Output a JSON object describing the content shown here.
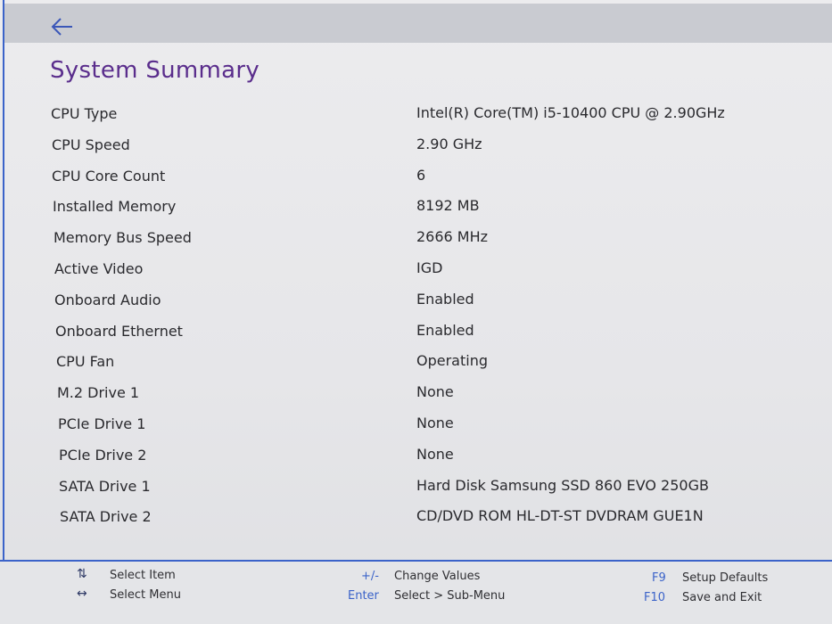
{
  "header": {
    "back_icon": "arrow-left-icon"
  },
  "page": {
    "title": "System Summary"
  },
  "summary": {
    "rows": [
      {
        "label": "CPU Type",
        "value": "Intel(R) Core(TM) i5-10400 CPU @ 2.90GHz"
      },
      {
        "label": "CPU Speed",
        "value": "2.90 GHz"
      },
      {
        "label": "CPU Core Count",
        "value": "6"
      },
      {
        "label": "Installed Memory",
        "value": "8192 MB"
      },
      {
        "label": "Memory Bus Speed",
        "value": "2666 MHz"
      },
      {
        "label": "Active Video",
        "value": "IGD"
      },
      {
        "label": "Onboard Audio",
        "value": "Enabled"
      },
      {
        "label": "Onboard Ethernet",
        "value": "Enabled"
      },
      {
        "label": "CPU Fan",
        "value": "Operating"
      },
      {
        "label": "M.2 Drive 1",
        "value": "None"
      },
      {
        "label": "PCIe Drive 1",
        "value": "None"
      },
      {
        "label": "PCIe Drive 2",
        "value": "None"
      },
      {
        "label": "SATA Drive 1",
        "value": "Hard Disk Samsung SSD 860 EVO 250GB"
      },
      {
        "label": "SATA Drive 2",
        "value": "CD/DVD ROM HL-DT-ST DVDRAM GUE1N"
      }
    ]
  },
  "footer": {
    "select_item_icon": "up-down-arrows-icon",
    "select_item": "Select Item",
    "select_menu_icon": "left-right-arrows-icon",
    "select_menu": "Select Menu",
    "change_values_key": "+/-",
    "change_values": "Change Values",
    "submenu_key": "Enter",
    "submenu": "Select > Sub-Menu",
    "defaults_key": "F9",
    "defaults": "Setup Defaults",
    "save_key": "F10",
    "save": "Save and Exit"
  },
  "colors": {
    "title": "#5a2d8c",
    "accent": "#3b63c9",
    "top_bar": "#c9cbd1"
  }
}
